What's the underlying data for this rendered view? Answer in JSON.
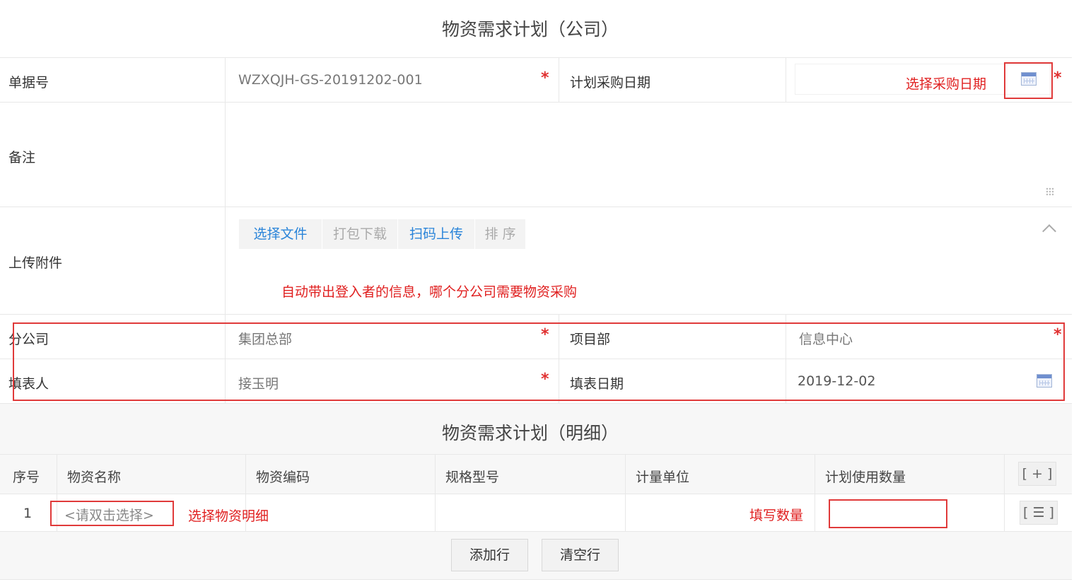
{
  "form": {
    "title": "物资需求计划（公司）",
    "doc_no": {
      "label": "单据号",
      "value": "WZXQJH-GS-20191202-001"
    },
    "purchase_date": {
      "label": "计划采购日期",
      "value": ""
    },
    "remark": {
      "label": "备注",
      "value": ""
    },
    "attachment": {
      "label": "上传附件",
      "buttons": [
        "选择文件",
        "打包下载",
        "扫码上传",
        "排 序"
      ]
    },
    "branch": {
      "label": "分公司",
      "value": "集团总部"
    },
    "project": {
      "label": "项目部",
      "value": "信息中心"
    },
    "filler": {
      "label": "填表人",
      "value": "接玉明"
    },
    "fill_date": {
      "label": "填表日期",
      "value": "2019-12-02"
    },
    "required_mark": "*"
  },
  "detail": {
    "title": "物资需求计划（明细）",
    "columns": [
      "序号",
      "物资名称",
      "物资编码",
      "规格型号",
      "计量单位",
      "计划使用数量"
    ],
    "add_col_button": "[ + ]",
    "rows": [
      {
        "no": "1",
        "name_placeholder": "<请双击选择>",
        "row_menu": "[ ☰ ]"
      }
    ],
    "footer_buttons": [
      "添加行",
      "清空行"
    ]
  },
  "annotations": {
    "select_date": "选择采购日期",
    "auto_info": "自动带出登入者的信息，哪个分公司需要物资采购",
    "select_item": "选择物资明细",
    "fill_qty": "填写数量"
  },
  "colors": {
    "annotation_red": "#e02020",
    "link_blue": "#2a84d9",
    "required_red": "#e03030"
  },
  "icons": [
    "calendar-icon",
    "chevron-up-icon",
    "resize-grip-icon"
  ]
}
